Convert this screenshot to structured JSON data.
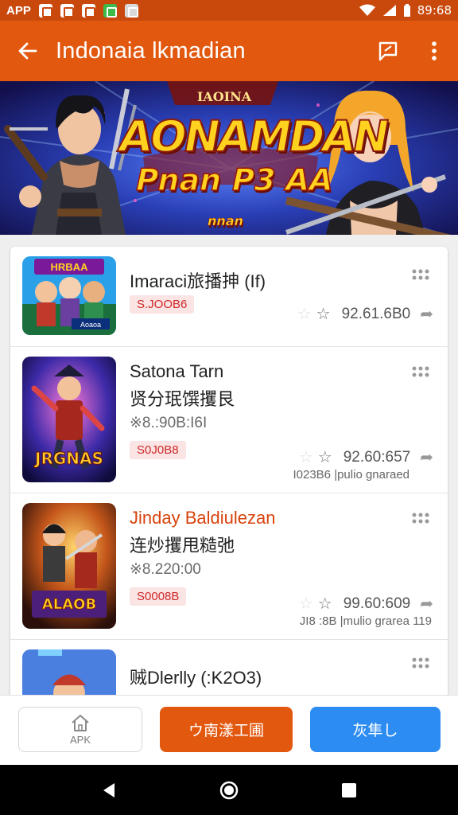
{
  "status_bar": {
    "app_label": "APP",
    "time": "89:68"
  },
  "app_bar": {
    "title": "Indonaia lkmadian",
    "icons": [
      "back-arrow-icon",
      "feedback-icon",
      "more-vert-icon"
    ]
  },
  "banner": {
    "top_text": "IAOINA",
    "title": "AONAMDAN",
    "subtitle": "Pnan P3 AA",
    "subtitle_tail": "nnan",
    "dots": 4,
    "active_dot": 1
  },
  "apps": [
    {
      "name": "Imaraci旅播抻 (If)",
      "tag": "S.JOOB6",
      "rating": "92.61.6B0",
      "thumb_title": "HRBAA",
      "thumb_caption": "Aoaoa"
    },
    {
      "name": "Satona Tarn",
      "name2": "贤分珉馔攫艮",
      "meta": "※8.:90B:I6I",
      "tag": "S0J0B8",
      "rating": "92.60:657",
      "footer": "I023B6 |pulio gnaraed",
      "thumb_title": "JRGNAS"
    },
    {
      "name": "Jinday Baldiulezan",
      "name2": "连炒攫甩糙弛",
      "meta": "※8.220:00",
      "tag": "S0008B",
      "rating": "99.60:609",
      "footer": "JI8 :8B |mulio grarea 119",
      "thumb_title": "ALAOB"
    },
    {
      "name": "贼Dlerlly (:K2O3)"
    }
  ],
  "action_bar": {
    "apk_label": "APK",
    "orange_label": "ウ南漾工圃",
    "blue_label": "灰隼し"
  },
  "colors": {
    "status_bar": "#c9490d",
    "app_bar": "#e2580f",
    "accent_blue": "#2c8cf2",
    "tag_red": "#cf2a2a"
  }
}
